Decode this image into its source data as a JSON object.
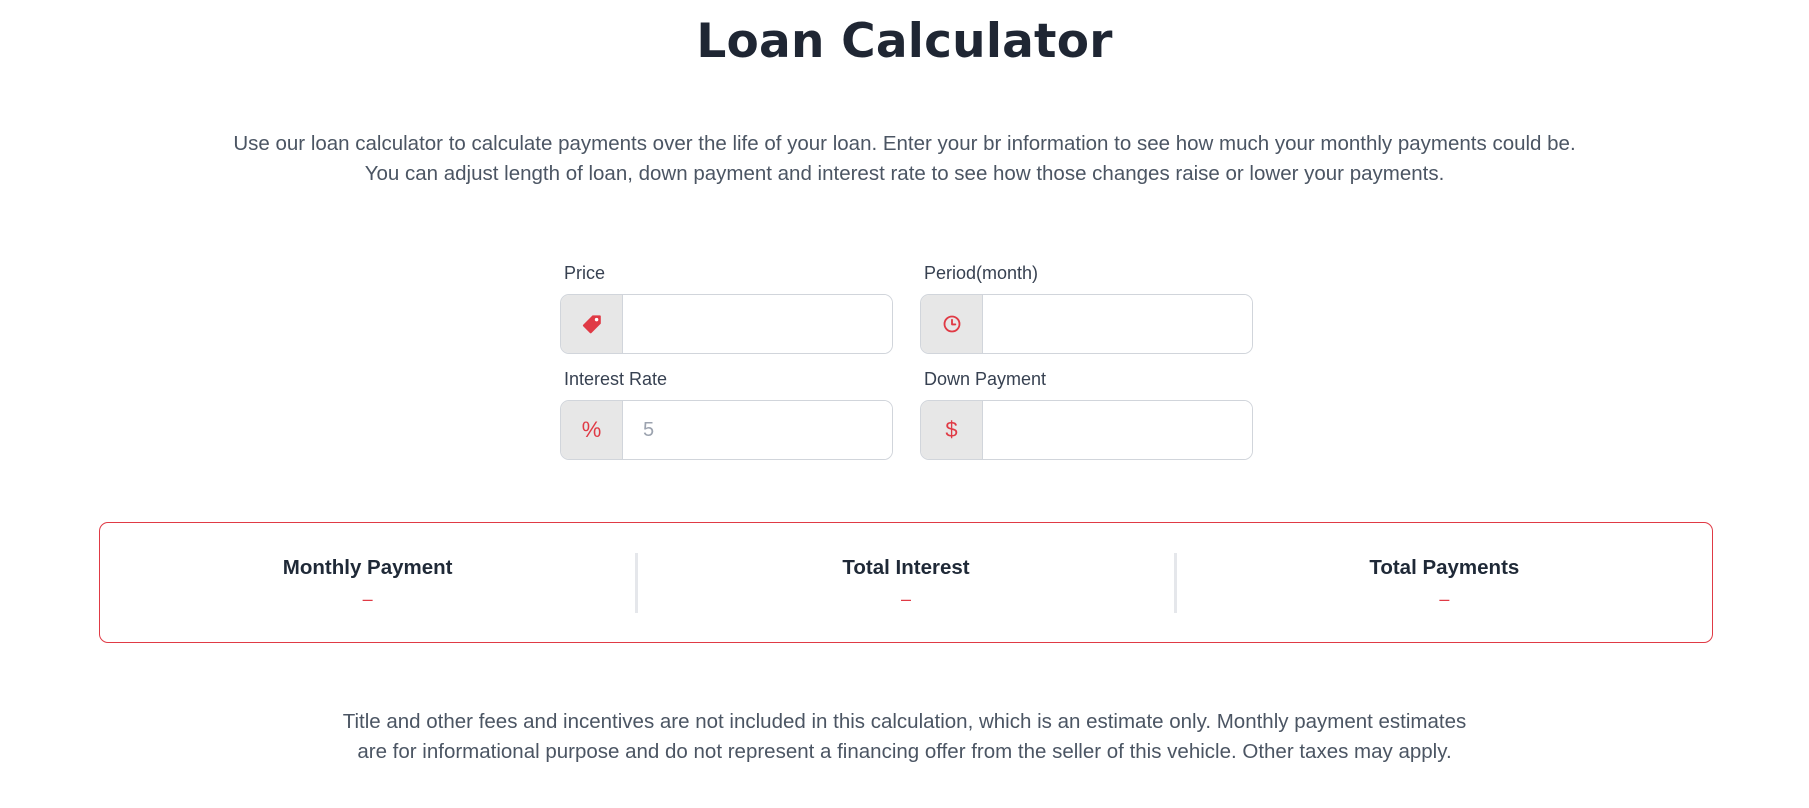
{
  "page": {
    "title": "Loan Calculator",
    "intro_line_1": "Use our loan calculator to calculate payments over the life of your loan. Enter your br information to see how much your monthly payments could be.",
    "intro_line_2": "You can adjust length of loan, down payment and interest rate to see how those changes raise or lower your payments."
  },
  "form": {
    "price": {
      "label": "Price",
      "value": "",
      "icon": "tag-icon"
    },
    "period": {
      "label": "Period(month)",
      "value": "",
      "icon": "clock-icon"
    },
    "interest_rate": {
      "label": "Interest Rate",
      "placeholder": "5",
      "value": "",
      "icon": "percent-icon",
      "icon_glyph": "%"
    },
    "down_payment": {
      "label": "Down Payment",
      "value": "",
      "icon": "dollar-icon",
      "icon_glyph": "$"
    }
  },
  "results": {
    "monthly_payment": {
      "label": "Monthly Payment",
      "value": "–"
    },
    "total_interest": {
      "label": "Total Interest",
      "value": "–"
    },
    "total_payments": {
      "label": "Total Payments",
      "value": "–"
    }
  },
  "disclaimer": {
    "line_1": "Title and other fees and incentives are not included in this calculation, which is an estimate only. Monthly payment estimates",
    "line_2": "are for informational purpose and do not represent a financing offer from the seller of this vehicle. Other taxes may apply."
  },
  "colors": {
    "accent": "#e03a45",
    "heading": "#1f2633",
    "body_text": "#4b5563",
    "addon_bg": "#e7e7e7",
    "border": "#d1d5db"
  }
}
